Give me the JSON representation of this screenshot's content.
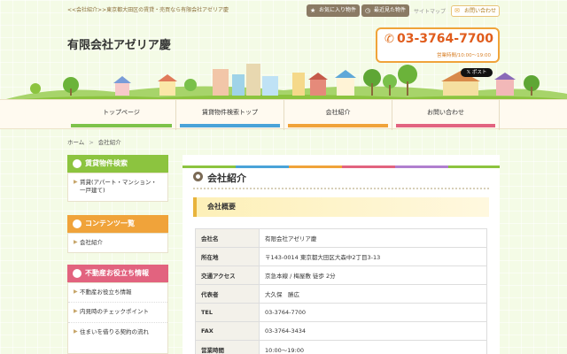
{
  "header": {
    "tagline": "<<会社紹介>>東京都大田区の賃貸・売買なら有限会社アゼリア慶",
    "favorites_label": "お気に入り物件",
    "recent_label": "最近見た物件",
    "sitemap_label": "サイトマップ",
    "contact_label": "お問い合わせ",
    "company_name": "有限会社アゼリア慶",
    "phone": "03-3764-7700",
    "hours": "営業時間/10:00〜19:00",
    "post_label": "ポスト"
  },
  "nav": {
    "items": [
      {
        "label": "トップページ",
        "color": "#7ec24a"
      },
      {
        "label": "賃貸物件検索トップ",
        "color": "#4aa3d8"
      },
      {
        "label": "会社紹介",
        "color": "#f0a33a"
      },
      {
        "label": "お問い合わせ",
        "color": "#e2637f"
      }
    ]
  },
  "breadcrumb": {
    "home": "ホーム",
    "separator": ">",
    "current": "会社紹介"
  },
  "sidebar": {
    "search": {
      "title": "賃貸物件検索",
      "color": "#8cc43f",
      "items": [
        "賃貸(アパート・マンション・一戸建て)"
      ]
    },
    "contents": {
      "title": "コンテンツ一覧",
      "color": "#f0a33a",
      "items": [
        "会社紹介"
      ]
    },
    "tips": {
      "title": "不動産お役立ち情報",
      "color": "#e2637f",
      "items": [
        "不動産お役立ち情報",
        "内見時のチェックポイント",
        "住まいを借りる契約の流れ"
      ]
    }
  },
  "main": {
    "title": "会社紹介",
    "section_title": "会社概要",
    "stripe_colors": [
      "#8cc43f",
      "#4aa3d8",
      "#f0a33a",
      "#e2637f",
      "#b07fcf",
      "#8cc43f"
    ],
    "rows": [
      {
        "label": "会社名",
        "value": "有限会社アゼリア慶"
      },
      {
        "label": "所在地",
        "value": "〒143-0014 東京都大田区大森中2丁目3-13"
      },
      {
        "label": "交通アクセス",
        "value": "京急本線 / 梅屋敷 徒歩 2分"
      },
      {
        "label": "代表者",
        "value": "大久保　勝広"
      },
      {
        "label": "TEL",
        "value": "03-3764-7700"
      },
      {
        "label": "FAX",
        "value": "03-3764-3434"
      },
      {
        "label": "営業時間",
        "value": "10:00〜19:00"
      }
    ]
  }
}
